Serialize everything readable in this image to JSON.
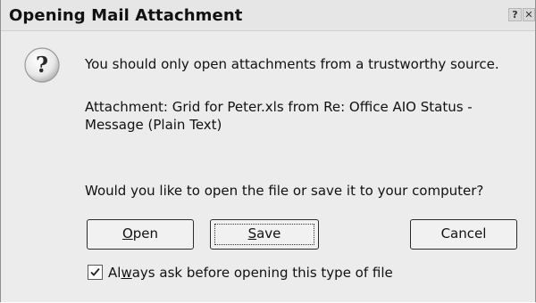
{
  "dialog": {
    "title": "Opening Mail Attachment",
    "help_glyph": "?",
    "close_glyph": "✕",
    "icon": "question-icon"
  },
  "message": {
    "warning": "You should only open attachments from a trustworthy source.",
    "attachment": "Attachment: Grid for Peter.xls from Re: Office AIO Status - Message (Plain Text)",
    "question": "Would you like to open the file or save it to your computer?"
  },
  "buttons": {
    "open": {
      "mnemonic": "O",
      "rest": "pen"
    },
    "save": {
      "mnemonic": "S",
      "rest": "ave"
    },
    "cancel": "Cancel"
  },
  "checkbox": {
    "checked": true,
    "label_before": "Al",
    "label_mnemonic": "w",
    "label_after": "ays ask before opening this type of file"
  }
}
